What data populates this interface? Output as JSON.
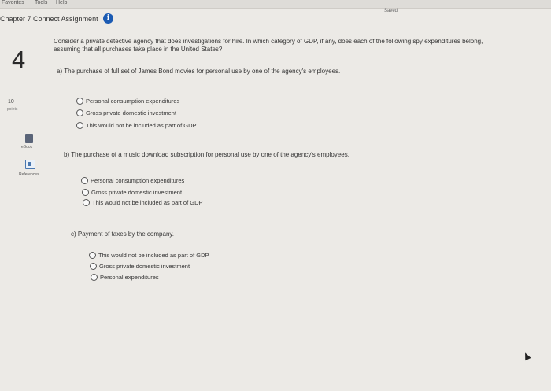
{
  "menubar": {
    "items": [
      "Favorites",
      "Tools",
      "Help"
    ]
  },
  "header": {
    "title": "Chapter 7 Connect Assignment",
    "info_glyph": "i",
    "saved_label": "Saved"
  },
  "question": {
    "number": "4",
    "points_value": "10",
    "points_label": "points",
    "prompt": "Consider a private detective agency that does investigations for hire. In which category of GDP, if any, does each of the following spy expenditures belong, assuming that all purchases take place in the United States?",
    "parts": [
      {
        "label": "a) The purchase of full set of James Bond movies for personal use by one of the agency's employees.",
        "options": [
          "Personal consumption expenditures",
          "Gross private domestic investment",
          "This would not be included as part of GDP"
        ]
      },
      {
        "label": "b) The purchase of a music download subscription for personal use by one of the agency's employees.",
        "options": [
          "Personal consumption expenditures",
          "Gross private domestic investment",
          "This would not be included as part of GDP"
        ]
      },
      {
        "label": "c) Payment of taxes by the company.",
        "options": [
          "This would not be included as part of GDP",
          "Gross private domestic investment",
          "Personal expenditures"
        ]
      }
    ]
  },
  "sidebar": {
    "ebook_label": "eBook",
    "references_label": "References"
  },
  "colors": {
    "accent": "#1b5bb3",
    "background": "#eceae6"
  }
}
